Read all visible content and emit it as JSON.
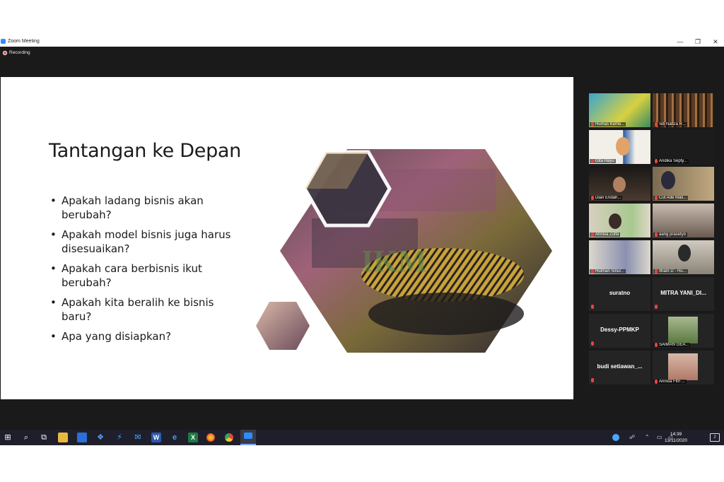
{
  "window": {
    "title": "Zoom Meeting",
    "minimize": "—",
    "restore": "❐",
    "close": "✕"
  },
  "meeting": {
    "recording_label": "Recording"
  },
  "slide": {
    "title": "Tantangan ke Depan",
    "bullets": [
      "Apakah ladang bisnis akan berubah?",
      "Apakah model bisnis juga harus disesuaikan?",
      "Apakah cara berbisnis ikut berubah?",
      "Apakah kita beralih ke bisnis baru?",
      "Apa yang disiapkan?"
    ],
    "watermark": "IKM"
  },
  "participants": [
    {
      "name": "Humas Keme...",
      "video": true,
      "tone": "#39a0c7"
    },
    {
      "name": "Siti Nafiza R...",
      "video": true,
      "tone": "#6b4a34"
    },
    {
      "name": "Gita Hayu",
      "video": true,
      "tone": "#e9e4d8"
    },
    {
      "name": "Andika Septy...",
      "video": false,
      "tone": "#1c1c1c"
    },
    {
      "name": "Dian Endah...",
      "video": true,
      "tone": "#2f2a28"
    },
    {
      "name": "Cut Ade Mali...",
      "video": true,
      "tone": "#6d5a40"
    },
    {
      "name": "Annisa Zulfa",
      "video": true,
      "tone": "#d8cfbd"
    },
    {
      "name": "aang prasetyo",
      "video": true,
      "tone": "#8d7c70"
    },
    {
      "name": "Hulman Sinur...",
      "video": true,
      "tone": "#c9c4b8"
    },
    {
      "name": "Ilham D - Hu...",
      "video": true,
      "tone": "#b9b2a6"
    },
    {
      "name": "suratno",
      "video": false,
      "tone": "#242424"
    },
    {
      "name": "MITRA YANI_DI...",
      "video": false,
      "tone": "#242424"
    },
    {
      "name": "Dessy-PPMKP",
      "video": false,
      "tone": "#242424"
    },
    {
      "name": "SAIMAN GEA...",
      "video": true,
      "tone": "#6e8a52"
    },
    {
      "name": "budi setiawan_...",
      "video": false,
      "tone": "#242424"
    },
    {
      "name": "Annisa Fitri ...",
      "video": true,
      "tone": "#c8a99a"
    }
  ],
  "taskbar": {
    "time": "14:39",
    "date": "13/11/2020",
    "notification_count": "2"
  }
}
